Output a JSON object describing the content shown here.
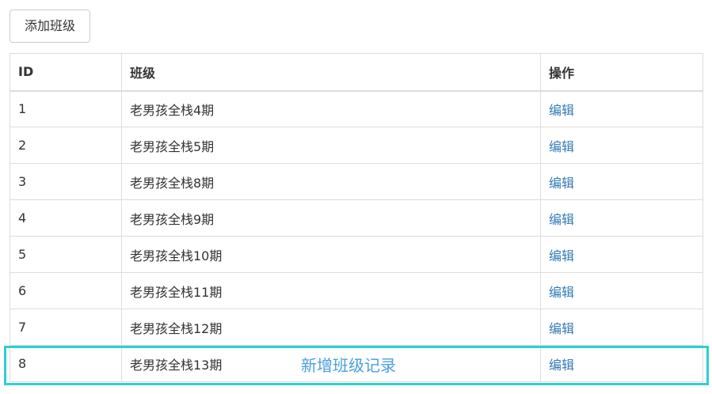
{
  "toolbar": {
    "add_label": "添加班级"
  },
  "table": {
    "headers": {
      "id": "ID",
      "name": "班级",
      "op": "操作"
    },
    "rows": [
      {
        "id": "1",
        "name": "老男孩全栈4期",
        "op": "编辑"
      },
      {
        "id": "2",
        "name": "老男孩全栈5期",
        "op": "编辑"
      },
      {
        "id": "3",
        "name": "老男孩全栈8期",
        "op": "编辑"
      },
      {
        "id": "4",
        "name": "老男孩全栈9期",
        "op": "编辑"
      },
      {
        "id": "5",
        "name": "老男孩全栈10期",
        "op": "编辑"
      },
      {
        "id": "6",
        "name": "老男孩全栈11期",
        "op": "编辑"
      },
      {
        "id": "7",
        "name": "老男孩全栈12期",
        "op": "编辑"
      },
      {
        "id": "8",
        "name": "老男孩全栈13期",
        "op": "编辑"
      }
    ]
  },
  "annotation": {
    "text": "新增班级记录",
    "color": "#4a9fe0",
    "box_color": "#2ecfd0"
  },
  "colors": {
    "link": "#337ab7",
    "text": "#333333",
    "border": "#dddddd"
  }
}
